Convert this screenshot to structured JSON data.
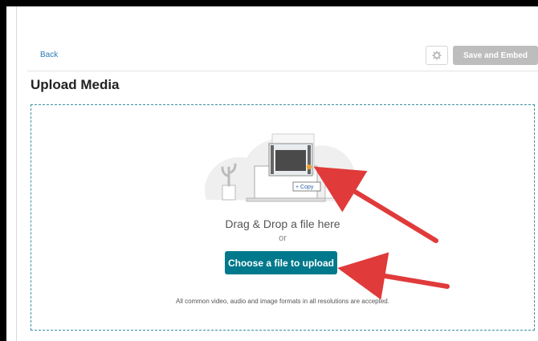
{
  "topbar": {
    "back_label": "Back",
    "settings_icon": "gear-icon",
    "save_embed_label": "Save and Embed"
  },
  "page": {
    "title": "Upload Media"
  },
  "dropzone": {
    "drag_text": "Drag & Drop a file here",
    "or_text": "or",
    "choose_label": "Choose a file to upload",
    "formats_text": "All common video, audio and image formats in all resolutions are accepted.",
    "copy_badge": "+ Copy"
  },
  "colors": {
    "accent": "#00798c",
    "link": "#2a7bb8",
    "disabled_button": "#bdbdbd",
    "annotation_arrow": "#e03a3a"
  }
}
